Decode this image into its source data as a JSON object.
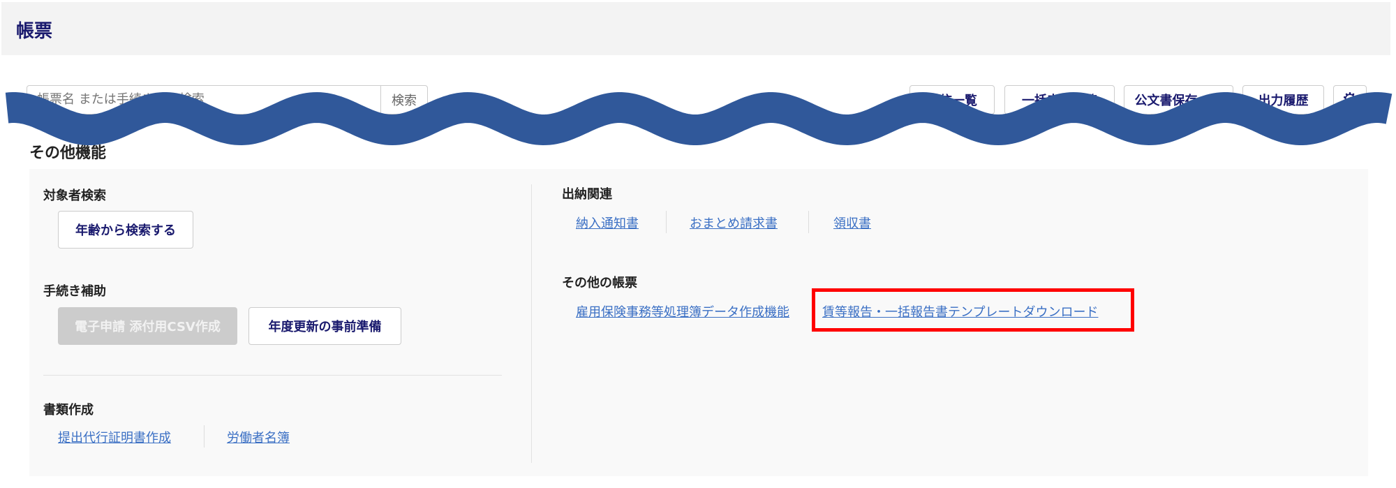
{
  "header": {
    "title": "帳票"
  },
  "search": {
    "placeholder": "帳票名 または手続き名で検索",
    "button_label": "検索"
  },
  "toolbar": {
    "buttons": [
      "送信一覧",
      "一括申請一覧",
      "公文書保存一覧",
      "出力履歴"
    ],
    "settings_icon": "gear-icon"
  },
  "section": {
    "title": "その他機能"
  },
  "left": {
    "target_search": {
      "heading": "対象者検索",
      "button": "年齢から検索する"
    },
    "procedure_support": {
      "heading": "手続き補助",
      "buttons": [
        {
          "label": "電子申請 添付用CSV作成",
          "disabled": true
        },
        {
          "label": "年度更新の事前準備",
          "disabled": false
        }
      ]
    },
    "documents": {
      "heading": "書類作成",
      "links": [
        "提出代行証明書作成",
        "労働者名簿"
      ]
    }
  },
  "right": {
    "payments": {
      "heading": "出納関連",
      "links": [
        "納入通知書",
        "おまとめ請求書",
        "領収書"
      ]
    },
    "other_forms": {
      "heading": "その他の帳票",
      "links": [
        "雇用保険事務等処理簿データ作成機能",
        "賃等報告・一括報告書テンプレートダウンロード"
      ]
    }
  },
  "colors": {
    "title": "#1a1a6e",
    "link": "#3a6fc4",
    "highlight": "#ff0000",
    "wave": "#30589a",
    "panel": "#f9f9f9"
  }
}
